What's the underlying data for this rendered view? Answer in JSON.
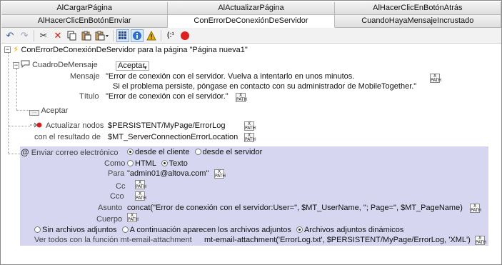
{
  "tabs_row1": [
    "AlCargarPágina",
    "AlActualizarPágina",
    "AlHacerClicEnBotónAtrás"
  ],
  "tabs_row2": [
    "AlHacerClicEnBotónEnviar",
    "ConErrorDeConexiónDeServidor",
    "CuandoHayaMensajeIncrustado"
  ],
  "active_tab": "ConErrorDeConexiónDeServidor",
  "toolbar": {
    "icons": [
      "undo-icon",
      "redo-icon",
      "cut-icon",
      "delete-icon",
      "copy-icon",
      "paste-icon",
      "paste-special-icon",
      "grid-view-icon",
      "info-icon",
      "warning-icon",
      "xpath-toggle-icon",
      "record-icon"
    ],
    "colors": {
      "record": "#e02020",
      "warning": "#e8b000",
      "info": "#2a6fd0"
    }
  },
  "tree": {
    "root": "ConErrorDeConexiónDeServidor para la página \"Página nueva1\"",
    "message_box": {
      "title": "CuadroDeMensaje",
      "button_value": "Aceptar",
      "message_label": "Mensaje",
      "message_line1": "\"Error de conexión con el servidor. Vuelva a intentarlo en unos minutos.",
      "message_line2": "Si el problema persiste, póngase en contacto con su administrador de MobileTogether.\"",
      "title_label": "Título",
      "title_value": "\"Error de conexión con el servidor.\"",
      "accept_branch": "Aceptar"
    },
    "update_nodes": {
      "label": "Actualizar nodos",
      "value": "$PERSISTENT/MyPage/ErrorLog",
      "result_label": "con el resultado de",
      "result_value": "$MT_ServerConnectionErrorLocation"
    },
    "email": {
      "label": "Enviar correo electrónico",
      "from_client": "desde el cliente",
      "from_server": "desde el servidor",
      "como_label": "Como",
      "html": "HTML",
      "texto": "Texto",
      "para_label": "Para",
      "para_value": "\"admin01@altova.com\"",
      "cc_label": "Cc",
      "cco_label": "Cco",
      "asunto_label": "Asunto",
      "asunto_value": "concat(\"Error de conexión con el servidor:User=\", $MT_UserName, \"; Page=\", $MT_PageName)",
      "cuerpo_label": "Cuerpo",
      "no_attach": "Sin archivos adjuntos",
      "next_attach": "A continuación aparecen los archivos adjuntos",
      "dyn_attach": "Archivos adjuntos dinámicos",
      "see_all_label": "Ver todos con la función mt-email-attachment",
      "see_all_value": "mt-email-attachment('ErrorLog.txt', $PERSISTENT/MyPage/ErrorLog, 'XML')"
    },
    "colors": {
      "email_background": "#d6d6f0",
      "lightning": "#f2a800"
    }
  }
}
